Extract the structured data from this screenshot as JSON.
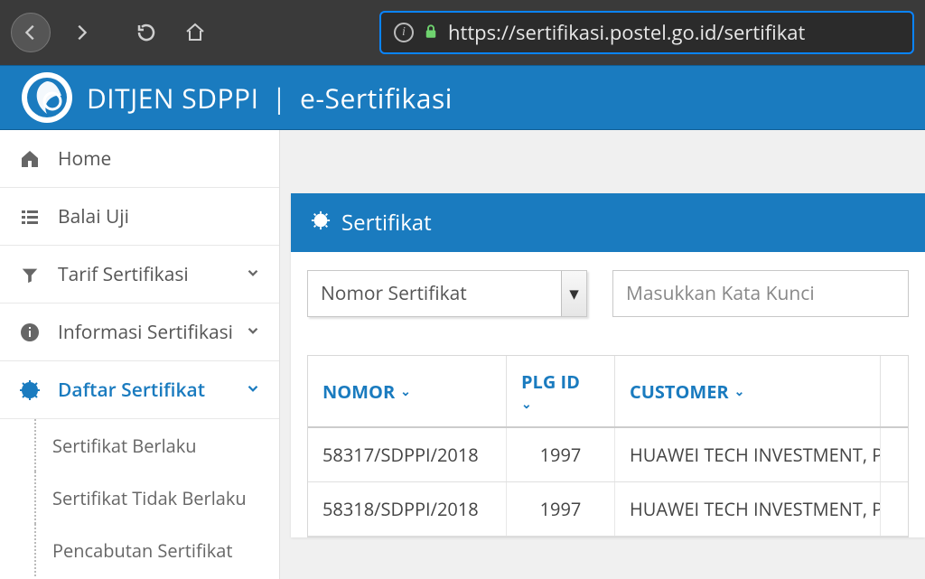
{
  "browser": {
    "url": "https://sertifikasi.postel.go.id/sertifikat"
  },
  "header": {
    "brand_main": "DITJEN SDPPI",
    "brand_sub": "e-Sertifikasi"
  },
  "sidebar": {
    "items": [
      {
        "label": "Home",
        "icon": "home"
      },
      {
        "label": "Balai Uji",
        "icon": "list"
      },
      {
        "label": "Tarif Sertifikasi",
        "icon": "filter",
        "expandable": true
      },
      {
        "label": "Informasi Sertifikasi",
        "icon": "info",
        "expandable": true
      },
      {
        "label": "Daftar Sertifikat",
        "icon": "seal",
        "expandable": true,
        "active": true
      }
    ],
    "subitems": [
      {
        "label": "Sertifikat Berlaku"
      },
      {
        "label": "Sertifikat Tidak Berlaku"
      },
      {
        "label": "Pencabutan Sertifikat"
      }
    ]
  },
  "card": {
    "title": "Sertifikat",
    "filter_select": "Nomor Sertifikat",
    "search_placeholder": "Masukkan Kata Kunci",
    "columns": {
      "nomor": "NOMOR",
      "plg": "PLG ID",
      "customer": "CUSTOMER"
    },
    "rows": [
      {
        "nomor": "58317/SDPPI/2018",
        "plg": "1997",
        "customer": "HUAWEI TECH INVESTMENT, PT."
      },
      {
        "nomor": "58318/SDPPI/2018",
        "plg": "1997",
        "customer": "HUAWEI TECH INVESTMENT, PT."
      }
    ]
  }
}
